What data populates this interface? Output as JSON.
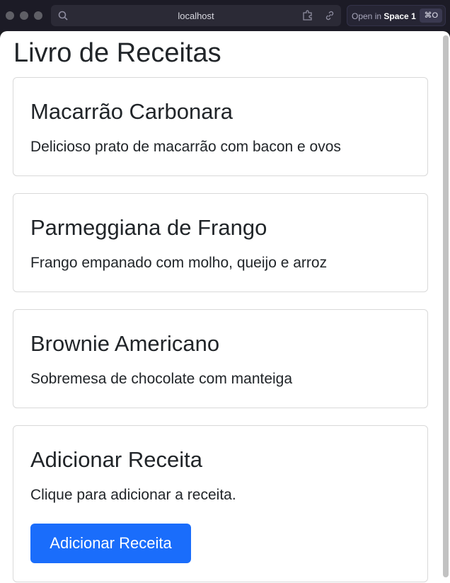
{
  "browser": {
    "url": "localhost",
    "open_in_prefix": "Open in",
    "open_in_target": "Space 1",
    "shortcut": "⌘O"
  },
  "page": {
    "title": "Livro de Receitas",
    "recipes": [
      {
        "title": "Macarrão Carbonara",
        "description": "Delicioso prato de macarrão com bacon e ovos"
      },
      {
        "title": "Parmeggiana de Frango",
        "description": "Frango empanado com molho, queijo e arroz"
      },
      {
        "title": "Brownie Americano",
        "description": "Sobremesa de chocolate com manteiga"
      }
    ],
    "add_card": {
      "title": "Adicionar Receita",
      "description": "Clique para adicionar a receita.",
      "button_label": "Adicionar Receita"
    }
  },
  "colors": {
    "primary_button": "#1a6dfb",
    "text": "#212529",
    "card_border": "#d9d9d9"
  }
}
